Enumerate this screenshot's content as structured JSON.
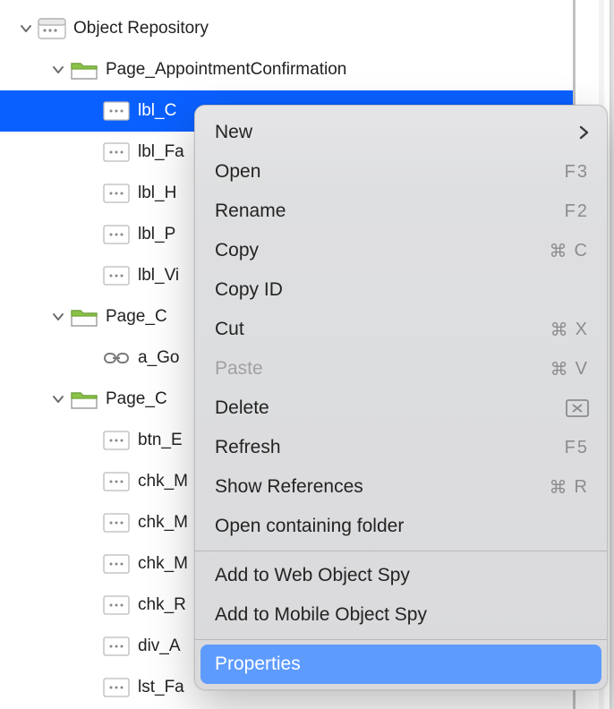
{
  "tree": {
    "root": {
      "label": "Object Repository"
    },
    "folders": [
      {
        "label": "Page_AppointmentConfirmation",
        "children_idx": [
          0,
          1,
          2,
          3,
          4
        ]
      },
      {
        "label": "Page_C",
        "children_idx": [
          5
        ]
      },
      {
        "label": "Page_C",
        "children_idx": [
          6,
          7,
          8,
          9,
          10,
          11,
          12
        ]
      }
    ],
    "items": [
      {
        "label": "lbl_C",
        "icon": "obj",
        "selected": true
      },
      {
        "label": "lbl_Fa",
        "icon": "obj"
      },
      {
        "label": "lbl_H",
        "icon": "obj"
      },
      {
        "label": "lbl_P",
        "icon": "obj"
      },
      {
        "label": "lbl_Vi",
        "icon": "obj"
      },
      {
        "label": "a_Go",
        "icon": "link"
      },
      {
        "label": "btn_E",
        "icon": "obj"
      },
      {
        "label": "chk_M",
        "icon": "obj"
      },
      {
        "label": "chk_M",
        "icon": "obj"
      },
      {
        "label": "chk_M",
        "icon": "obj"
      },
      {
        "label": "chk_R",
        "icon": "obj"
      },
      {
        "label": "div_A",
        "icon": "obj"
      },
      {
        "label": "lst_Fa",
        "icon": "obj"
      }
    ]
  },
  "menu": {
    "new": "New",
    "open": {
      "label": "Open",
      "shortcut": "F3"
    },
    "rename": {
      "label": "Rename",
      "shortcut": "F2"
    },
    "copy": {
      "label": "Copy",
      "shortcut_sym": "⌘",
      "shortcut_key": "C"
    },
    "copy_id": "Copy ID",
    "cut": {
      "label": "Cut",
      "shortcut_sym": "⌘",
      "shortcut_key": "X"
    },
    "paste": {
      "label": "Paste",
      "shortcut_sym": "⌘",
      "shortcut_key": "V"
    },
    "delete": "Delete",
    "refresh": {
      "label": "Refresh",
      "shortcut": "F5"
    },
    "show_refs": {
      "label": "Show References",
      "shortcut_sym": "⌘",
      "shortcut_key": "R"
    },
    "open_folder": "Open containing folder",
    "add_web": "Add to Web Object Spy",
    "add_mobile": "Add to Mobile Object Spy",
    "properties": "Properties"
  }
}
